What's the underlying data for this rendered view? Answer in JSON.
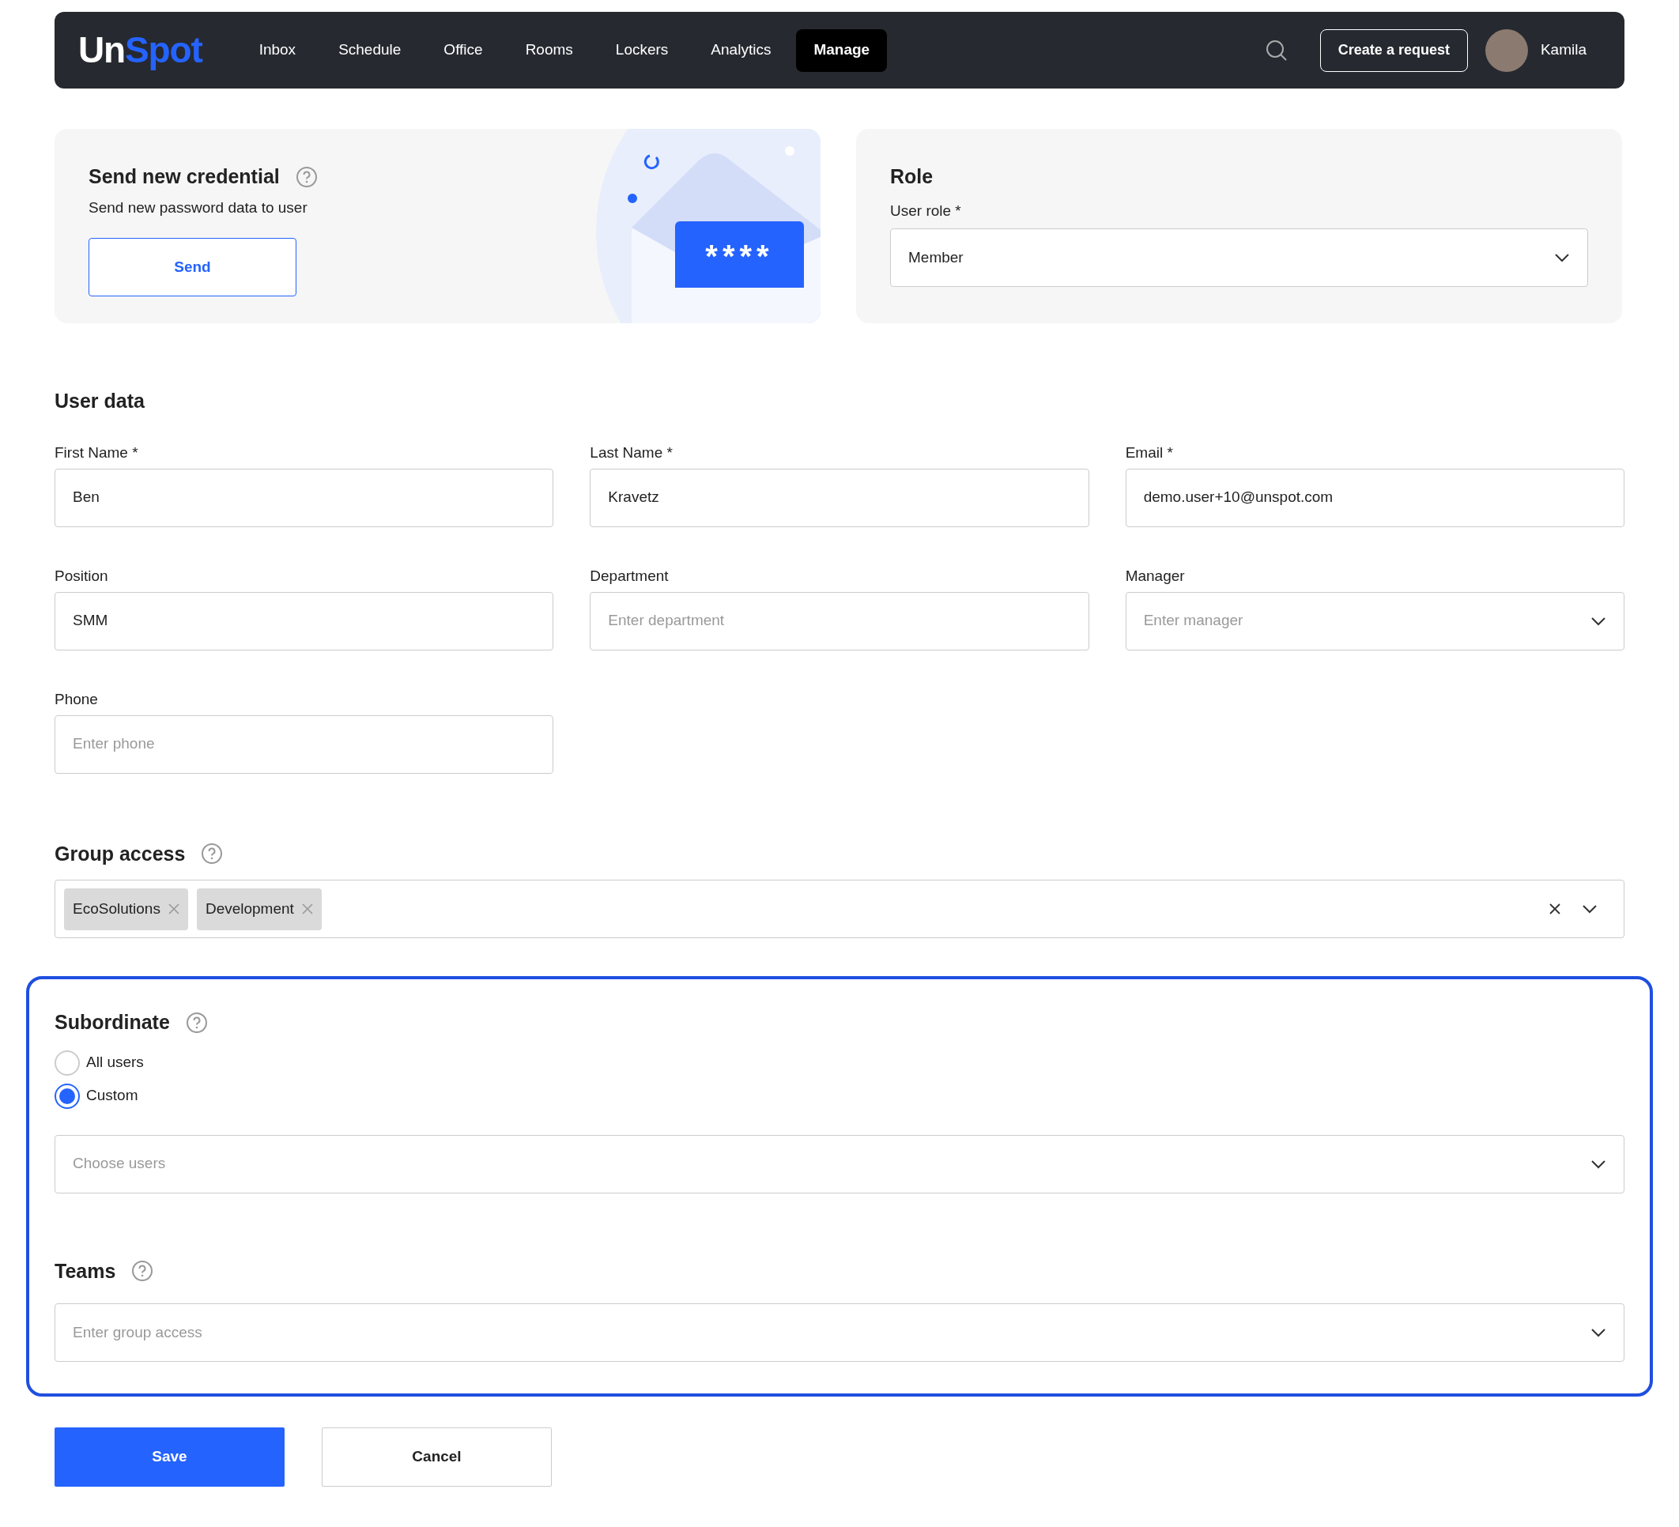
{
  "nav": {
    "logo_parts": [
      "Un",
      "Spot"
    ],
    "items": [
      {
        "label": "Inbox",
        "selected": false
      },
      {
        "label": "Schedule",
        "selected": false
      },
      {
        "label": "Office",
        "selected": false
      },
      {
        "label": "Rooms",
        "selected": false
      },
      {
        "label": "Lockers",
        "selected": false
      },
      {
        "label": "Analytics",
        "selected": false
      },
      {
        "label": "Manage",
        "selected": true
      }
    ],
    "create_button": "Create a request",
    "user": "Kamila"
  },
  "credential": {
    "title": "Send new credential",
    "subtitle": "Send new password data to user",
    "button": "Send",
    "illustration_text": "****"
  },
  "role": {
    "title": "Role",
    "label": "User role *",
    "value": "Member"
  },
  "user_data": {
    "title": "User data",
    "fields": [
      {
        "label": "First Name *",
        "value": "Ben",
        "kind": "text"
      },
      {
        "label": "Last Name *",
        "value": "Kravetz",
        "kind": "text"
      },
      {
        "label": "Email *",
        "value": "demo.user+10@unspot.com",
        "kind": "text"
      },
      {
        "label": "Position",
        "value": "SMM",
        "kind": "text"
      },
      {
        "label": "Department",
        "placeholder": "Enter department",
        "kind": "text"
      },
      {
        "label": "Manager",
        "placeholder": "Enter manager",
        "kind": "select"
      },
      {
        "label": "Phone",
        "placeholder": "Enter phone",
        "kind": "text"
      }
    ]
  },
  "group_access": {
    "title": "Group access",
    "tags": [
      "EcoSolutions",
      "Development"
    ]
  },
  "subordinate": {
    "title": "Subordinate",
    "options": [
      {
        "label": "All users",
        "selected": false
      },
      {
        "label": "Custom",
        "selected": true
      }
    ],
    "placeholder": "Choose users"
  },
  "teams": {
    "title": "Teams",
    "placeholder": "Enter group access"
  },
  "buttons": {
    "save": "Save",
    "cancel": "Cancel"
  }
}
